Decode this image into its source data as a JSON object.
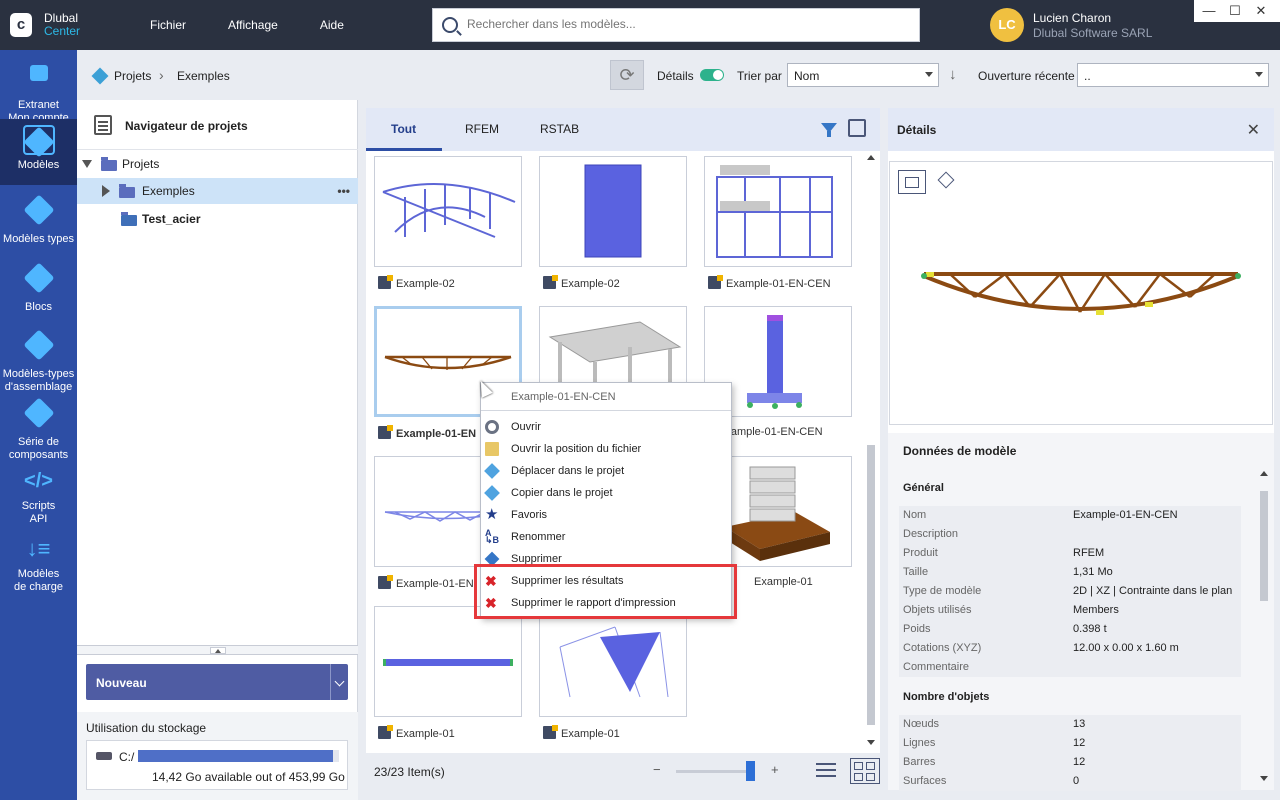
{
  "app": {
    "name": "Dlubal",
    "sub": "Center",
    "logo_letter": "c"
  },
  "menu": [
    "Fichier",
    "Affichage",
    "Aide"
  ],
  "search": {
    "placeholder": "Rechercher dans les modèles..."
  },
  "user": {
    "initials": "LC",
    "name": "Lucien Charon",
    "company": "Dlubal Software SARL"
  },
  "window_controls": [
    "—",
    "☐",
    "✕"
  ],
  "rail": [
    {
      "label_1": "Extranet",
      "label_2": "Mon compte"
    },
    {
      "label_1": "Modèles",
      "label_2": ""
    },
    {
      "label_1": "Modèles types",
      "label_2": ""
    },
    {
      "label_1": "Blocs",
      "label_2": ""
    },
    {
      "label_1": "Modèles-types",
      "label_2": "d'assemblage"
    },
    {
      "label_1": "Série de",
      "label_2": "composants"
    },
    {
      "label_1": "Scripts",
      "label_2": "API"
    },
    {
      "label_1": "Modèles",
      "label_2": "de charge"
    }
  ],
  "breadcrumb": {
    "root": "Projets",
    "sep": "›",
    "current": "Exemples"
  },
  "toolbar": {
    "refresh_glyph": "⟳",
    "details_label": "Détails",
    "details_on": true,
    "sort_label": "Trier par",
    "sort_value": "Nom",
    "sort_dir_glyph": "↓",
    "recent_label": "Ouverture récente",
    "recent_value": ".."
  },
  "navigator": {
    "title": "Navigateur de projets",
    "tree": [
      {
        "label": "Projets"
      },
      {
        "label": "Exemples",
        "more": "•••"
      },
      {
        "label": "Test_acier"
      }
    ],
    "new_button": "Nouveau",
    "storage_title": "Utilisation du stockage",
    "drive": "C:/",
    "storage_info": "14,42 Go available out of 453,99 Go",
    "storage_used_fraction": 0.97
  },
  "tabs": [
    "Tout",
    "RFEM",
    "RSTAB"
  ],
  "models": [
    {
      "name": "Example-02"
    },
    {
      "name": "Example-02"
    },
    {
      "name": "Example-01-EN-CEN"
    },
    {
      "name": "Example-01-EN"
    },
    {
      "name": ""
    },
    {
      "name": "Example-01-EN-CEN"
    },
    {
      "name": "Example-01-EN"
    },
    {
      "name": ""
    },
    {
      "name": "Example-01"
    },
    {
      "name": "Example-01"
    },
    {
      "name": "Example-01"
    }
  ],
  "status": {
    "count": "23/23 Item(s)",
    "zoom_minus": "−",
    "zoom_plus": "+"
  },
  "context_menu": {
    "title": "Example-01-EN-CEN",
    "items": [
      {
        "label": "Ouvrir",
        "icon": "gear-icon"
      },
      {
        "label": "Ouvrir la position du fichier",
        "icon": "folder-icon"
      },
      {
        "label": "Déplacer dans le projet",
        "icon": "move-icon"
      },
      {
        "label": "Copier dans le projet",
        "icon": "copy-icon"
      },
      {
        "label": "Favoris",
        "icon": "star-icon"
      },
      {
        "label": "Renommer",
        "icon": "rename-icon"
      },
      {
        "label": "Supprimer",
        "icon": "delete-icon"
      },
      {
        "label": "Supprimer les résultats",
        "icon": "delete-results-icon"
      },
      {
        "label": "Supprimer le rapport d'impression",
        "icon": "delete-report-icon"
      }
    ]
  },
  "details": {
    "title": "Détails",
    "close": "✕",
    "data_title": "Données de modèle",
    "general_title": "Général",
    "general": [
      {
        "k": "Nom",
        "v": "Example-01-EN-CEN"
      },
      {
        "k": "Description",
        "v": ""
      },
      {
        "k": "Produit",
        "v": "RFEM"
      },
      {
        "k": "Taille",
        "v": "1,31 Mo"
      },
      {
        "k": "Type de modèle",
        "v": "2D | XZ | Contrainte dans le plan"
      },
      {
        "k": "Objets utilisés",
        "v": "Members"
      },
      {
        "k": "Poids",
        "v": "0.398 t"
      },
      {
        "k": "Cotations (XYZ)",
        "v": "12.00 x 0.00 x 1.60 m"
      },
      {
        "k": "Commentaire",
        "v": ""
      }
    ],
    "objects_title": "Nombre d'objets",
    "objects": [
      {
        "k": "Nœuds",
        "v": "13"
      },
      {
        "k": "Lignes",
        "v": "12"
      },
      {
        "k": "Barres",
        "v": "12"
      },
      {
        "k": "Surfaces",
        "v": "0"
      }
    ]
  },
  "colors": {
    "accent": "#2d4ea5",
    "titlebar": "#2a3140",
    "highlight": "#e5383b"
  }
}
